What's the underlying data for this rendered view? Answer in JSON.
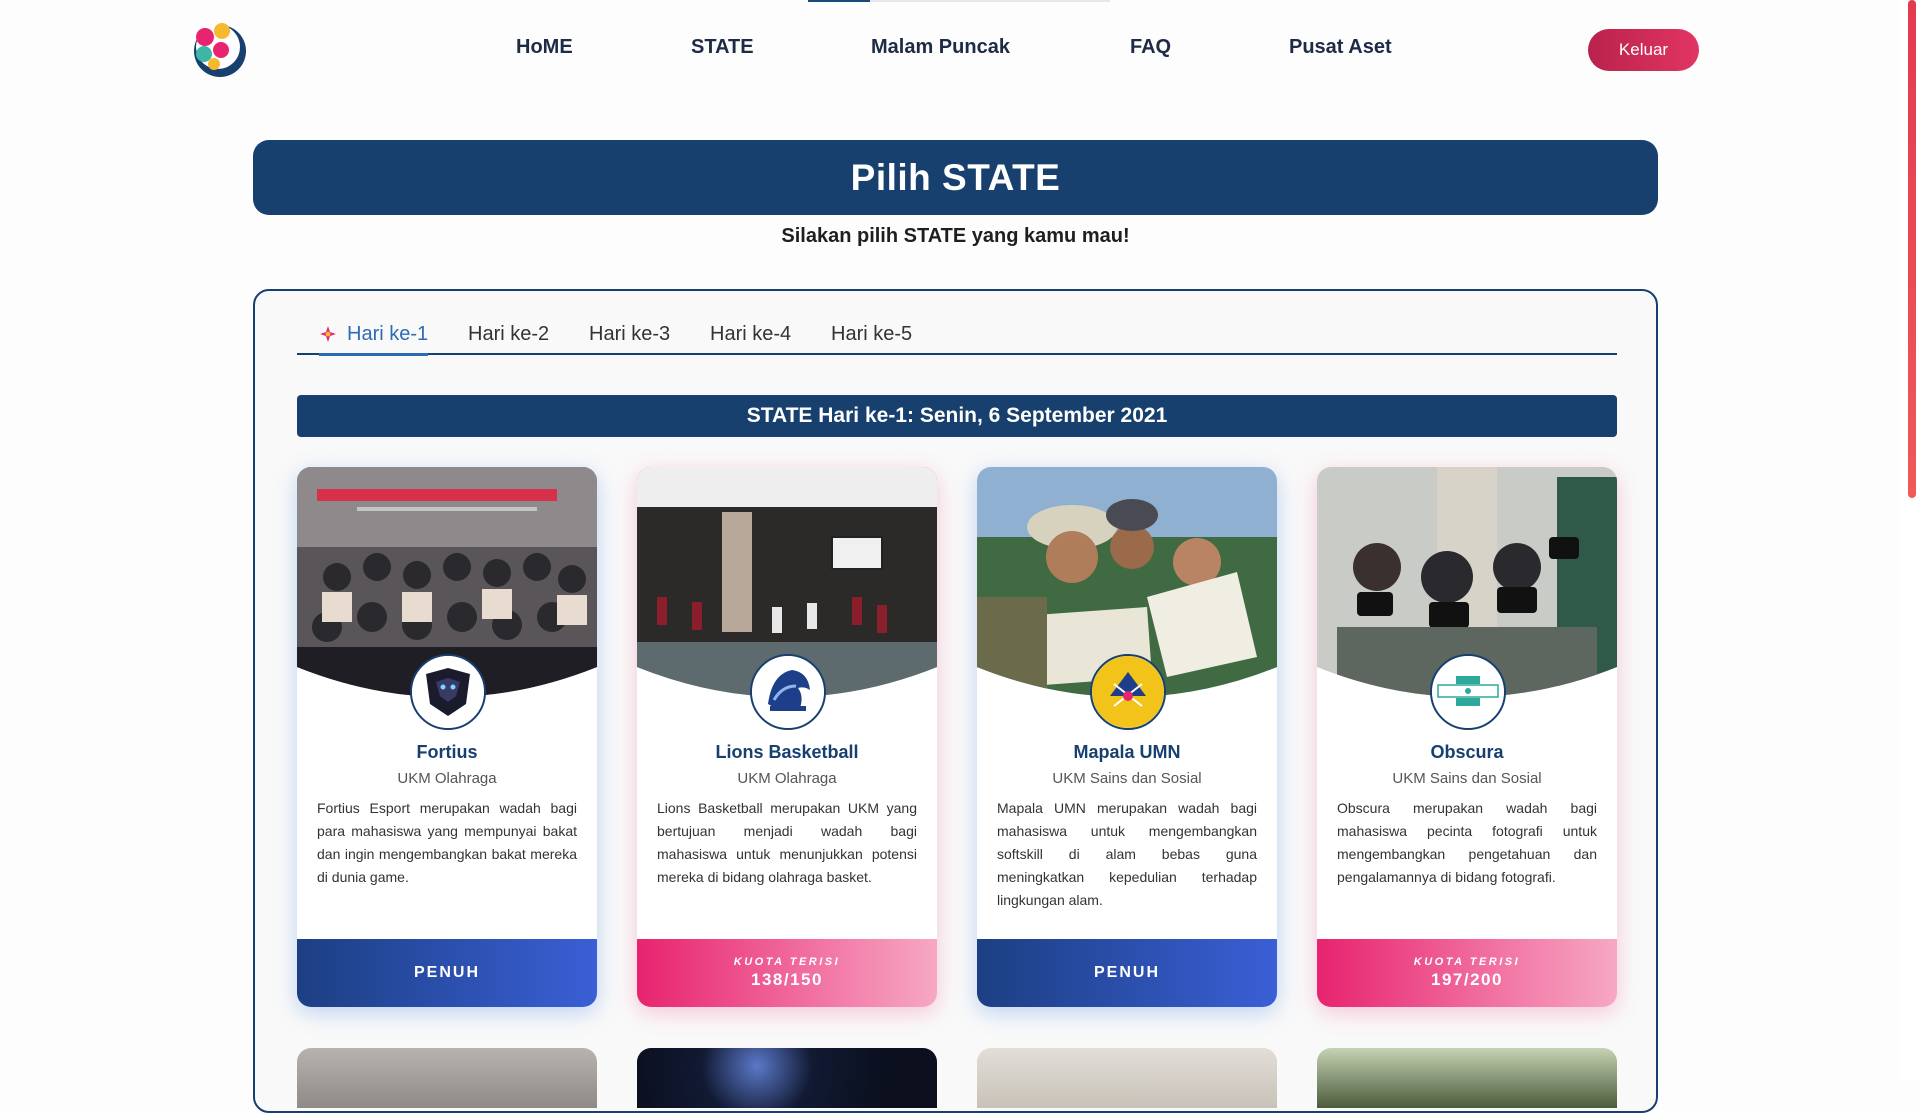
{
  "nav": {
    "items": [
      "HoME",
      "STATE",
      "Malam Puncak",
      "FAQ",
      "Pusat Aset"
    ],
    "logout_label": "Keluar"
  },
  "page": {
    "title": "Pilih STATE",
    "subtitle": "Silakan pilih STATE yang kamu mau!"
  },
  "tabs": [
    "Hari ke-1",
    "Hari ke-2",
    "Hari ke-3",
    "Hari ke-4",
    "Hari ke-5"
  ],
  "active_tab": "Hari ke-1",
  "day_heading": "STATE Hari ke-1: Senin, 6 September 2021",
  "cards": [
    {
      "name": "Fortius",
      "category": "UKM Olahraga",
      "description": "Fortius Esport merupakan wadah bagi para mahasiswa yang mempunyai bakat dan ingin mengembangkan bakat mereka di dunia game.",
      "status": "PENUH"
    },
    {
      "name": "Lions Basketball",
      "category": "UKM Olahraga",
      "description": "Lions Basketball merupakan UKM yang bertujuan menjadi wadah bagi mahasiswa untuk menunjukkan potensi mereka di bidang olahraga basket.",
      "quota_label": "KUOTA TERISI",
      "quota_value": "138/150"
    },
    {
      "name": "Mapala UMN",
      "category": "UKM Sains dan Sosial",
      "description": "Mapala UMN merupakan wadah bagi mahasiswa untuk mengembangkan softskill di alam bebas guna meningkatkan kepedulian terhadap lingkungan alam.",
      "status": "PENUH"
    },
    {
      "name": "Obscura",
      "category": "UKM Sains dan Sosial",
      "description": "Obscura merupakan wadah bagi mahasiswa pecinta fotografi untuk mengembangkan pengetahuan dan pengalamannya di bidang fotografi.",
      "quota_label": "KUOTA TERISI",
      "quota_value": "197/200"
    }
  ],
  "colors": {
    "primary": "#17406f",
    "accent_pink": "#e8236f",
    "logout": "#c8285a"
  }
}
